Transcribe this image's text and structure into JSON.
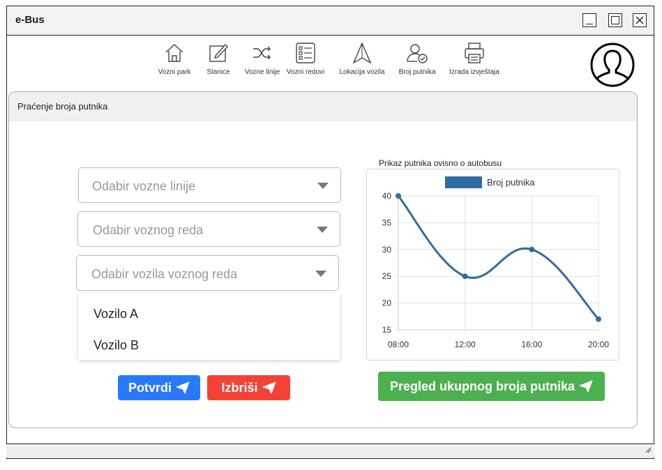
{
  "app": {
    "title": "e-Bus"
  },
  "nav": {
    "items": [
      {
        "label": "Vozni park",
        "icon": "home-icon"
      },
      {
        "label": "Stanice",
        "icon": "edit-icon"
      },
      {
        "label": "Vozne linije",
        "icon": "shuffle-icon"
      },
      {
        "label": "Vozni redovi",
        "icon": "list-icon"
      },
      {
        "label": "Lokacija vozila",
        "icon": "navigation-icon"
      },
      {
        "label": "Broj putnika",
        "icon": "user-check-icon"
      },
      {
        "label": "Izrada izvještaja",
        "icon": "printer-icon"
      }
    ]
  },
  "panel": {
    "title": "Praćenje broja putnika"
  },
  "form": {
    "line_select": "Odabir vozne linije",
    "schedule_select": "Odabir voznog reda",
    "vehicle_select": "Odabir vozila voznog reda",
    "vehicle_options": [
      "Vozilo A",
      "Vozilo B"
    ]
  },
  "buttons": {
    "confirm": "Potvrdi",
    "delete": "Izbriši",
    "overview": "Pregled ukupnog broja putnika"
  },
  "colors": {
    "confirm": "#2979ff",
    "delete": "#f44336",
    "overview": "#4caf50",
    "series": "#2e6da4"
  },
  "chart_data": {
    "type": "line",
    "title": "Prikaz putnika ovisno o autobusu",
    "legend_position": "top",
    "categories": [
      "08:00",
      "12:00",
      "16:00",
      "20:00"
    ],
    "series": [
      {
        "name": "Broj putnika",
        "values": [
          40,
          25,
          30,
          17
        ]
      }
    ],
    "y_ticks": [
      15,
      20,
      25,
      30,
      35,
      40
    ],
    "ylim": [
      15,
      40
    ],
    "grid": true,
    "smooth": true
  }
}
